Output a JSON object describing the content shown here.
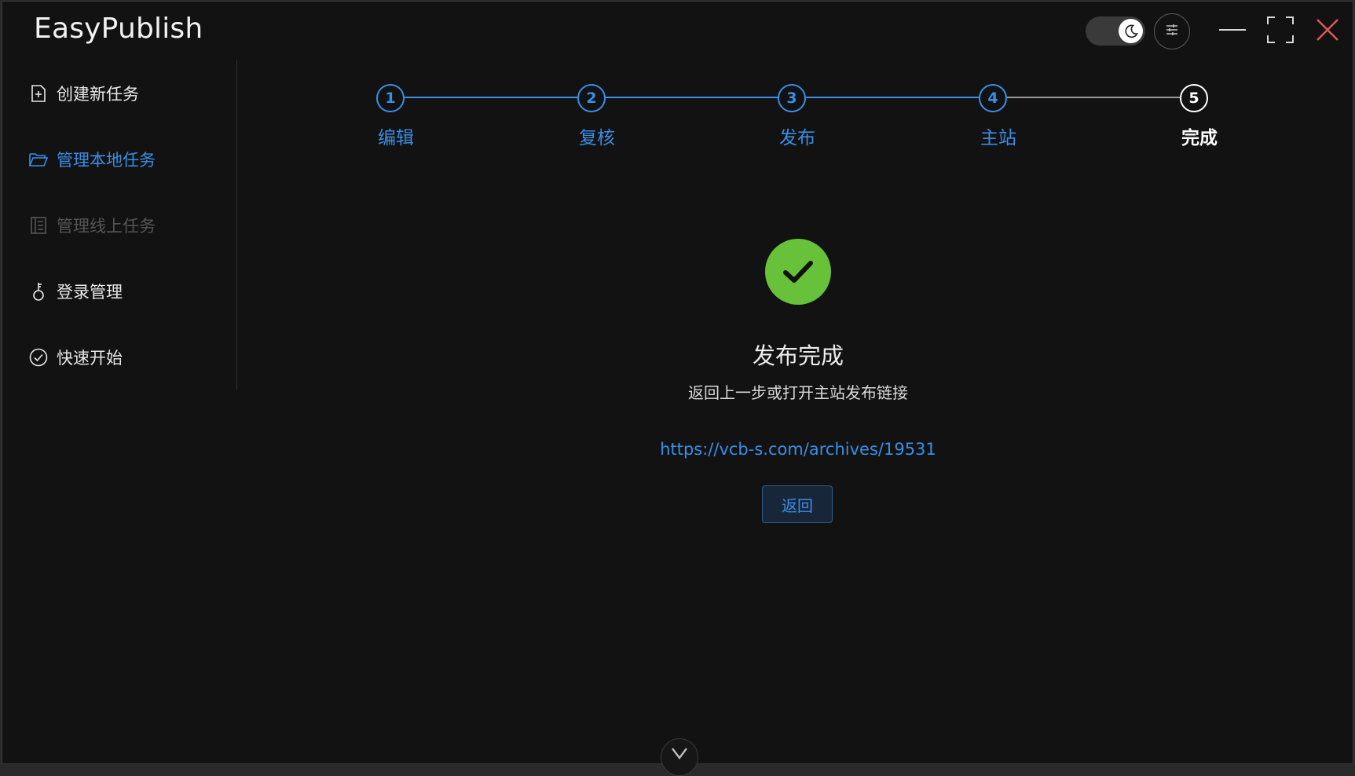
{
  "app": {
    "title": "EasyPublish"
  },
  "header": {
    "theme_toggle_icon": "moon-icon",
    "settings_icon": "sliders-icon",
    "window_controls": [
      "minimize-icon",
      "maximize-icon",
      "close-icon"
    ]
  },
  "sidebar": {
    "items": [
      {
        "label": "创建新任务",
        "icon": "file-plus-icon",
        "state": "normal"
      },
      {
        "label": "管理本地任务",
        "icon": "folder-open-icon",
        "state": "active"
      },
      {
        "label": "管理线上任务",
        "icon": "notebook-icon",
        "state": "disabled"
      },
      {
        "label": "登录管理",
        "icon": "key-icon",
        "state": "normal"
      },
      {
        "label": "快速开始",
        "icon": "check-circle-icon",
        "state": "normal"
      }
    ]
  },
  "steps": [
    {
      "number": "1",
      "label": "编辑",
      "status": "done"
    },
    {
      "number": "2",
      "label": "复核",
      "status": "done"
    },
    {
      "number": "3",
      "label": "发布",
      "status": "done"
    },
    {
      "number": "4",
      "label": "主站",
      "status": "done"
    },
    {
      "number": "5",
      "label": "完成",
      "status": "current"
    }
  ],
  "result": {
    "icon": "success-check-icon",
    "title": "发布完成",
    "subtitle": "返回上一步或打开主站发布链接",
    "link": "https://vcb-s.com/archives/19531",
    "back_button": "返回"
  },
  "scroll_hint_icon": "chevron-down-icon",
  "colors": {
    "accent": "#3a8ee6",
    "success": "#67c23a",
    "close": "#e05a55",
    "background": "#121212"
  }
}
